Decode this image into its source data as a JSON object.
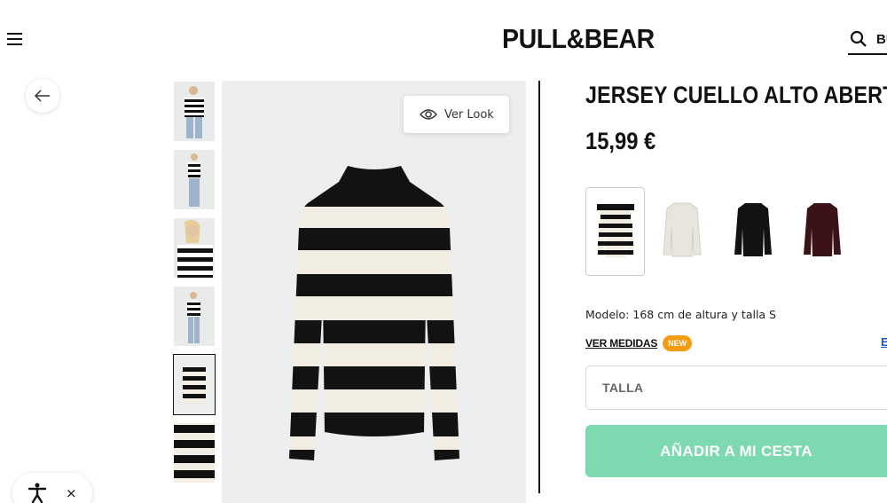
{
  "header": {
    "logo": "PULL&BEAR",
    "search_label": "BU"
  },
  "gallery": {
    "ver_look_label": "Ver Look",
    "thumbnails": [
      "model-front",
      "model-side",
      "model-closeup",
      "model-full",
      "product-flat",
      "product-detail"
    ],
    "active_thumbnail": 5
  },
  "product": {
    "title": "JERSEY CUELLO ALTO ABERTUR",
    "price": "15,99 €",
    "colors": [
      {
        "name": "striped-black-white",
        "selected": true,
        "color": "#111111"
      },
      {
        "name": "cream",
        "selected": false,
        "color": "#e8e4de"
      },
      {
        "name": "black",
        "selected": false,
        "color": "#121212"
      },
      {
        "name": "burgundy",
        "selected": false,
        "color": "#3a1218"
      }
    ],
    "model_info": "Modelo: 168 cm de altura y talla S",
    "measures_label": "VER MEDIDAS",
    "new_badge": "NEW",
    "cut_link": "E",
    "size_placeholder": "TALLA",
    "add_to_cart": "AÑADIR A MI CESTA"
  },
  "colors": {
    "accent_green": "#7dd9b0",
    "badge_orange": "#f39c12",
    "link_blue": "#1f55b8"
  },
  "accessibility": {
    "close_label": "×"
  }
}
